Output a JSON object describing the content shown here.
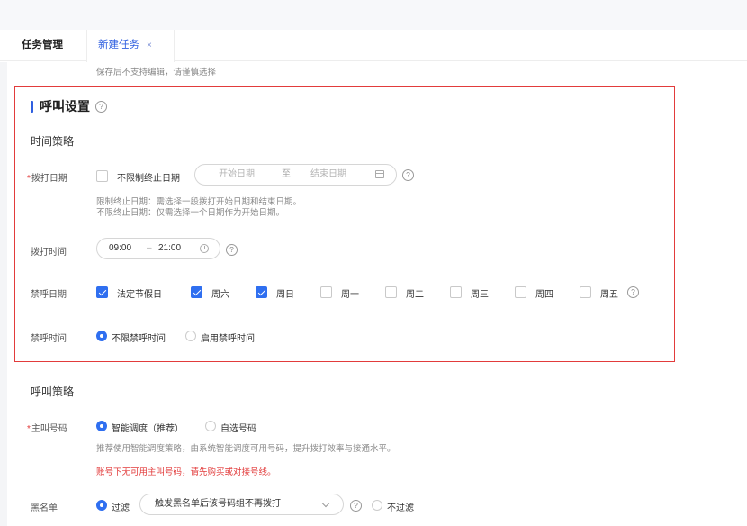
{
  "tabs": [
    {
      "label": "任务管理"
    },
    {
      "label": "新建任务",
      "close": "×"
    }
  ],
  "hint_top": "保存后不支持编辑，请谨慎选择",
  "call_settings": {
    "title": "呼叫设置",
    "help": "?",
    "time_strategy": {
      "title": "时间策略",
      "dial_date": {
        "label": "拨打日期",
        "required": "*",
        "unlimited_checkbox": {
          "label": "不限制终止日期",
          "checked": false
        },
        "start_placeholder": "开始日期",
        "separator": "至",
        "end_placeholder": "结束日期",
        "note_line1": "限制终止日期：需选择一段拨打开始日期和结束日期。",
        "note_line2": "不限终止日期：仅需选择一个日期作为开始日期。"
      },
      "dial_time": {
        "label": "拨打时间",
        "start": "09:00",
        "separator": "–",
        "end": "21:00"
      },
      "forbidden_days": {
        "label": "禁呼日期",
        "options": [
          {
            "label": "法定节假日",
            "checked": true
          },
          {
            "label": "周六",
            "checked": true
          },
          {
            "label": "周日",
            "checked": true
          },
          {
            "label": "周一",
            "checked": false
          },
          {
            "label": "周二",
            "checked": false
          },
          {
            "label": "周三",
            "checked": false
          },
          {
            "label": "周四",
            "checked": false
          },
          {
            "label": "周五",
            "checked": false
          }
        ]
      },
      "forbidden_time": {
        "label": "禁呼时间",
        "options": [
          {
            "label": "不限禁呼时间",
            "checked": true
          },
          {
            "label": "启用禁呼时间",
            "checked": false
          }
        ]
      }
    }
  },
  "call_strategy": {
    "title": "呼叫策略",
    "caller_number": {
      "label": "主叫号码",
      "required": "*",
      "options": [
        {
          "label": "智能调度（推荐）",
          "checked": true
        },
        {
          "label": "自选号码",
          "checked": false
        }
      ],
      "note": "推荐使用智能调度策略，由系统智能调度可用号码，提升拨打效率与接通水平。",
      "warning": "账号下无可用主叫号码，请先购买或对接号线。"
    },
    "blacklist": {
      "label": "黑名单",
      "filter_option": {
        "label": "过滤",
        "checked": true
      },
      "select_value": "触发黑名单后该号码组不再拨打",
      "no_filter_option": {
        "label": "不过滤",
        "checked": false
      }
    }
  },
  "colors": {
    "accent": "#2f6ff0",
    "tab_active": "#2f5fe0",
    "highlight_border": "#e23b3b",
    "required": "#e23b3b"
  }
}
